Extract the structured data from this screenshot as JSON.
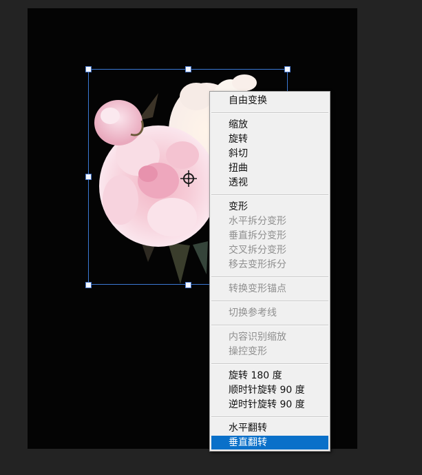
{
  "menu": {
    "groups": [
      {
        "items": [
          {
            "label": "自由变换",
            "enabled": true
          }
        ]
      },
      {
        "items": [
          {
            "label": "缩放",
            "enabled": true
          },
          {
            "label": "旋转",
            "enabled": true
          },
          {
            "label": "斜切",
            "enabled": true
          },
          {
            "label": "扭曲",
            "enabled": true
          },
          {
            "label": "透视",
            "enabled": true
          }
        ]
      },
      {
        "items": [
          {
            "label": "变形",
            "enabled": true
          },
          {
            "label": "水平拆分变形",
            "enabled": false
          },
          {
            "label": "垂直拆分变形",
            "enabled": false
          },
          {
            "label": "交叉拆分变形",
            "enabled": false
          },
          {
            "label": "移去变形拆分",
            "enabled": false
          }
        ]
      },
      {
        "items": [
          {
            "label": "转换变形锚点",
            "enabled": false
          }
        ]
      },
      {
        "items": [
          {
            "label": "切换参考线",
            "enabled": false
          }
        ]
      },
      {
        "items": [
          {
            "label": "内容识别缩放",
            "enabled": false
          },
          {
            "label": "操控变形",
            "enabled": false
          }
        ]
      },
      {
        "items": [
          {
            "label": "旋转 180 度",
            "enabled": true
          },
          {
            "label": "顺时针旋转 90 度",
            "enabled": true
          },
          {
            "label": "逆时针旋转 90 度",
            "enabled": true
          }
        ]
      },
      {
        "items": [
          {
            "label": "水平翻转",
            "enabled": true
          },
          {
            "label": "垂直翻转",
            "enabled": true,
            "highlighted": true
          }
        ]
      }
    ]
  },
  "colors": {
    "workspace": "#232323",
    "canvas": "#040404",
    "menu_background": "#f0f0f0",
    "highlight": "#0a70c9",
    "transform_border": "#3b79d6"
  },
  "icons": {
    "pivot": "crosshair-icon",
    "handle": "transform-handle"
  }
}
